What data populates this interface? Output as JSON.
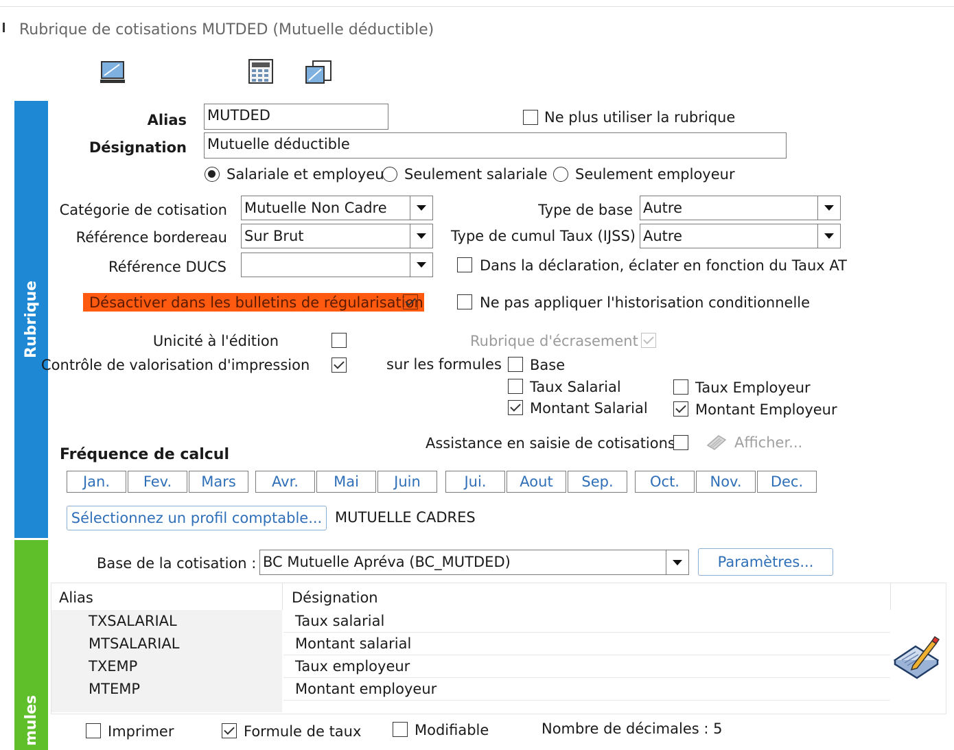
{
  "window": {
    "title": "Rubrique de cotisations MUTDED (Mutuelle déductible)"
  },
  "toolbar": {
    "icons": [
      "monitor-icon",
      "calculator-icon",
      "windows-icon"
    ]
  },
  "sidebar": {
    "tab_rubrique": "Rubrique",
    "tab_formules": "mules"
  },
  "form": {
    "alias_label": "Alias",
    "alias_value": "MUTDED",
    "designation_label": "Désignation",
    "designation_value": "Mutuelle déductible",
    "ne_plus_utiliser": "Ne plus utiliser la rubrique",
    "radio_sal_emp": "Salariale et employeur",
    "radio_sal": "Seulement salariale",
    "radio_emp": "Seulement employeur",
    "categorie_label": "Catégorie de cotisation",
    "categorie_value": "Mutuelle Non Cadre",
    "ref_bordereau_label": "Référence bordereau",
    "ref_bordereau_value": "Sur Brut",
    "ref_ducs_label": "Référence DUCS",
    "ref_ducs_value": "",
    "type_base_label": "Type de base",
    "type_base_value": "Autre",
    "type_cumul_label": "Type de cumul Taux (IJSS)",
    "type_cumul_value": "Autre",
    "eclater_label": "Dans la déclaration, éclater en fonction du Taux AT",
    "desactiver_label": "Désactiver dans les bulletins de régularisation",
    "historisation_label": "Ne pas appliquer l'historisation conditionnelle",
    "unicite_label": "Unicité à l'édition",
    "controle_label": "Contrôle de valorisation d'impression",
    "ecrasement_label": "Rubrique d'écrasement",
    "sur_formules_label": "sur les formules :",
    "f_base": "Base",
    "f_taux_salarial": "Taux Salarial",
    "f_montant_salarial": "Montant Salarial",
    "f_taux_employeur": "Taux Employeur",
    "f_montant_employeur": "Montant Employeur",
    "assistance_label": "Assistance en saisie de cotisations",
    "afficher_label": "Afficher...",
    "frequence_label": "Fréquence de calcul",
    "months": [
      "Jan.",
      "Fev.",
      "Mars",
      "Avr.",
      "Mai",
      "Juin",
      "Jui.",
      "Aout",
      "Sep.",
      "Oct.",
      "Nov.",
      "Dec."
    ],
    "profil_button": "Sélectionnez un profil comptable...",
    "profil_value": "MUTUELLE CADRES"
  },
  "formules": {
    "base_label": "Base de la cotisation :",
    "base_value": "BC Mutuelle Apréva (BC_MUTDED)",
    "parametres_button": "Paramètres...",
    "table_headers": [
      "Alias",
      "Désignation"
    ],
    "rows": [
      {
        "alias": "TXSALARIAL",
        "designation": "Taux salarial"
      },
      {
        "alias": "MTSALARIAL",
        "designation": "Montant salarial"
      },
      {
        "alias": "TXEMP",
        "designation": "Taux employeur"
      },
      {
        "alias": "MTEMP",
        "designation": "Montant employeur"
      }
    ],
    "imprimer_label": "Imprimer",
    "formule_taux_label": "Formule de taux",
    "modifiable_label": "Modifiable",
    "decimales_label": "Nombre de décimales : 5"
  },
  "colors": {
    "sidebar_blue": "#1e88d4",
    "sidebar_green": "#5fbf2a",
    "highlight_orange": "#ff5a10",
    "link_blue": "#2f6fb8"
  }
}
